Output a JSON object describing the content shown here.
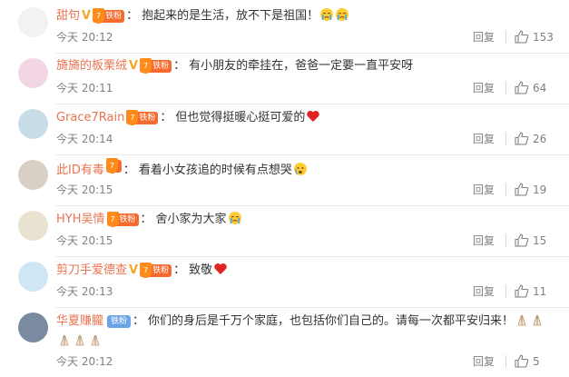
{
  "comments": [
    {
      "user": "甜句",
      "has_v": true,
      "fan_badge": true,
      "fan_level": "7",
      "fan_label": "铁粉",
      "text": "抱起来的是生活，放不下是祖国！",
      "emojis": [
        "cry",
        "cry"
      ],
      "time": "今天 20:12",
      "reply": "回复",
      "likes": "153"
    },
    {
      "user": "旖旖的板栗绒",
      "has_v": true,
      "fan_badge": true,
      "fan_level": "7",
      "fan_label": "铁粉",
      "text": "有小朋友的牵挂在，爸爸一定要一直平安呀",
      "emojis": [],
      "time": "今天 20:11",
      "reply": "回复",
      "likes": "64"
    },
    {
      "user": "Grace7Rain",
      "has_v": false,
      "fan_badge": true,
      "fan_level": "7",
      "fan_label": "铁粉",
      "text": "但也觉得挺暖心挺可爱的",
      "emojis": [
        "heart"
      ],
      "time": "今天 20:14",
      "reply": "回复",
      "likes": "26"
    },
    {
      "user": "此ID有毒",
      "has_v": false,
      "fan_badge": true,
      "fan_level": "7",
      "fan_label": "",
      "text": "看着小女孩追的时候有点想哭",
      "emojis": [
        "sob"
      ],
      "time": "今天 20:15",
      "reply": "回复",
      "likes": "19"
    },
    {
      "user": "HYH吴情",
      "has_v": false,
      "fan_badge": true,
      "fan_level": "7",
      "fan_label": "铁粉",
      "text": "舍小家为大家",
      "emojis": [
        "cry"
      ],
      "time": "今天 20:15",
      "reply": "回复",
      "likes": "15"
    },
    {
      "user": "剪刀手爱德查",
      "has_v": true,
      "fan_badge": true,
      "fan_level": "7",
      "fan_label": "铁粉",
      "text": "致敬",
      "emojis": [
        "heart"
      ],
      "time": "今天 20:13",
      "reply": "回复",
      "likes": "11"
    },
    {
      "user": "华夏赚朧",
      "has_v": false,
      "fan_badge": false,
      "silver_label": "铁粉",
      "text": "你们的身后是千万个家庭，也包括你们自己的。请每一次都平安归来！",
      "emojis": [
        "pray",
        "pray"
      ],
      "line2_emojis": [
        "pray",
        "pray",
        "pray"
      ],
      "time": "今天 20:12",
      "reply": "回复",
      "likes": "5"
    }
  ],
  "colors": {
    "username": "#eb7350",
    "meta": "#808080",
    "divider": "#e8e8e8"
  }
}
